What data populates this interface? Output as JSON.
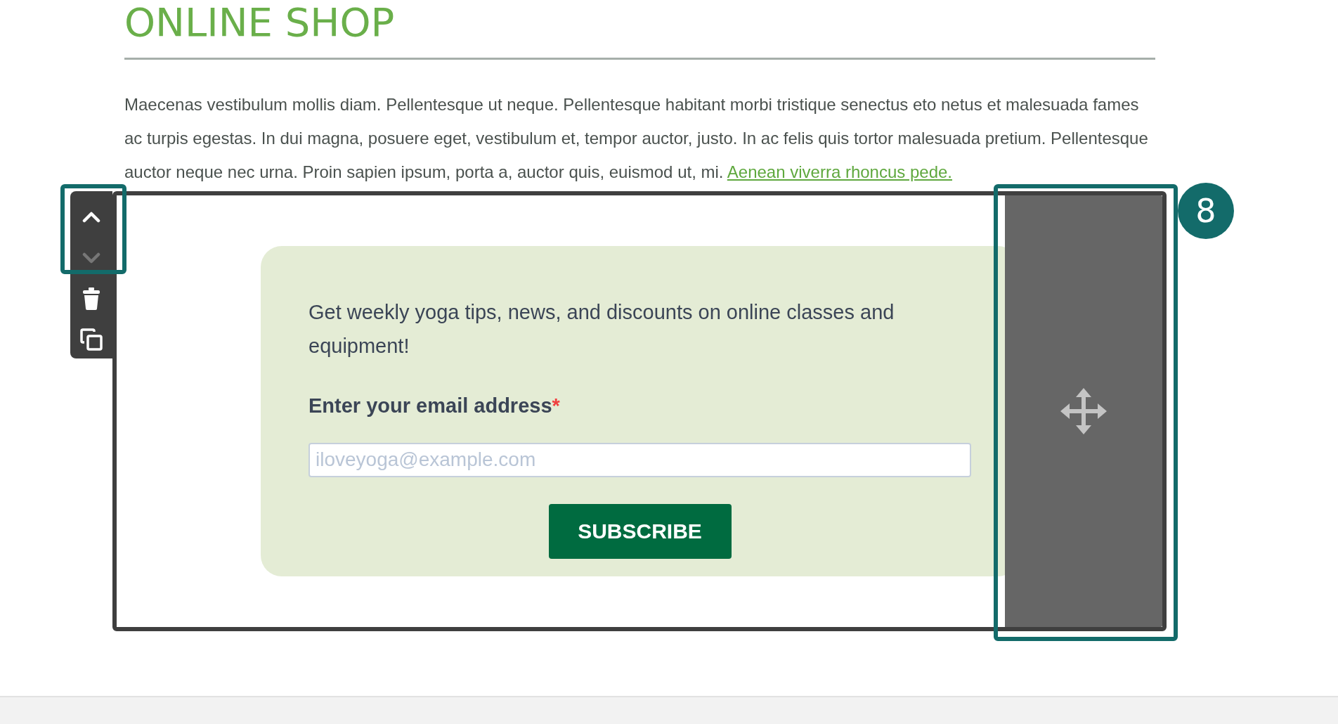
{
  "page": {
    "heading": "ONLINE SHOP",
    "paragraph": "Maecenas vestibulum mollis diam. Pellentesque ut neque. Pellentesque habitant morbi tristique senectus eto netus et malesuada fames ac turpis egestas. In dui magna, posuere eget, vestibulum et, tempor auctor, justo. In ac felis quis tortor malesuada pretium. Pellentesque auctor neque nec urna. Proin sapien ipsum, porta a, auctor quis, euismod ut, mi.",
    "link": "Aenean viverra rhoncus pede."
  },
  "block_toolbar": {
    "move_highlighted": true,
    "buttons": [
      {
        "kind": "up",
        "disabled": false
      },
      {
        "kind": "down",
        "disabled": true
      },
      {
        "kind": "delete",
        "disabled": false
      },
      {
        "kind": "duplicate",
        "disabled": false
      }
    ]
  },
  "drag_handle": {
    "highlighted": true
  },
  "tour_badge": "8",
  "signup": {
    "intro": "Get weekly yoga tips, news, and discounts on online classes and equipment!",
    "label": "Enter your email address",
    "required_mark": "*",
    "placeholder": "iloveyoga@example.com",
    "button": "SUBSCRIBE"
  }
}
